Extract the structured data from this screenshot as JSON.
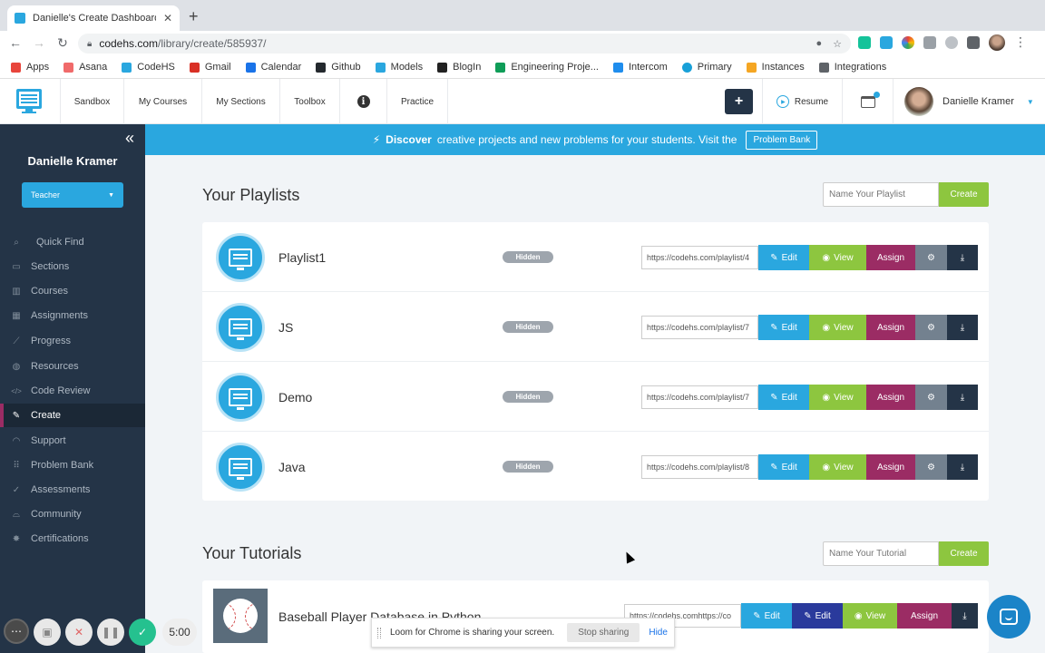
{
  "browser": {
    "tab_title": "Danielle's Create Dashboard | C",
    "tab_close": "✕",
    "new_tab": "+",
    "url_host": "codehs.com",
    "url_path": "/library/create/585937/",
    "bookmarks": [
      {
        "label": "Apps",
        "color": "#e8453c"
      },
      {
        "label": "Asana",
        "color": "#f06a6a"
      },
      {
        "label": "CodeHS",
        "color": "#2aa7df"
      },
      {
        "label": "Gmail",
        "color": "#d93025"
      },
      {
        "label": "Calendar",
        "color": "#1a73e8"
      },
      {
        "label": "Github",
        "color": "#24292e"
      },
      {
        "label": "Models",
        "color": "#2aa7df"
      },
      {
        "label": "BlogIn",
        "color": "#222222"
      },
      {
        "label": "Engineering Proje...",
        "color": "#0f9d58"
      },
      {
        "label": "Intercom",
        "color": "#1f8ded"
      },
      {
        "label": "Primary",
        "color": "#18a0d8"
      },
      {
        "label": "Instances",
        "color": "#f5a623"
      },
      {
        "label": "Integrations",
        "color": "#5f6368"
      }
    ]
  },
  "header": {
    "nav": [
      "Sandbox",
      "My Courses",
      "My Sections",
      "Toolbox",
      "Practice"
    ],
    "info": "i",
    "plus": "+",
    "resume": "Resume",
    "user_name": "Danielle Kramer"
  },
  "sidebar": {
    "user_name": "Danielle Kramer",
    "role": "Teacher",
    "items": [
      {
        "label": "Quick Find",
        "icon": "search-icon",
        "glyph": "⌕"
      },
      {
        "label": "Sections",
        "icon": "monitor-icon",
        "glyph": "▭"
      },
      {
        "label": "Courses",
        "icon": "book-icon",
        "glyph": "▥"
      },
      {
        "label": "Assignments",
        "icon": "calendar-icon",
        "glyph": "▦"
      },
      {
        "label": "Progress",
        "icon": "chart-icon",
        "glyph": "⟋"
      },
      {
        "label": "Resources",
        "icon": "bulb-icon",
        "glyph": "◍"
      },
      {
        "label": "Code Review",
        "icon": "code-icon",
        "glyph": "</>"
      },
      {
        "label": "Create",
        "icon": "pencil-icon",
        "glyph": "✎"
      },
      {
        "label": "Support",
        "icon": "headset-icon",
        "glyph": "◠"
      },
      {
        "label": "Problem Bank",
        "icon": "grid-icon",
        "glyph": "⠿"
      },
      {
        "label": "Assessments",
        "icon": "check-icon",
        "glyph": "✓"
      },
      {
        "label": "Community",
        "icon": "people-icon",
        "glyph": "⌓"
      },
      {
        "label": "Certifications",
        "icon": "badge-icon",
        "glyph": "✸"
      }
    ]
  },
  "banner": {
    "bold": "Discover",
    "text": "creative projects and new problems for your students. Visit the",
    "button": "Problem Bank"
  },
  "playlists": {
    "title": "Your Playlists",
    "input_placeholder": "Name Your Playlist",
    "create": "Create",
    "rows": [
      {
        "name": "Playlist1",
        "status": "Hidden",
        "link": "https://codehs.com/playlist/4"
      },
      {
        "name": "JS",
        "status": "Hidden",
        "link": "https://codehs.com/playlist/7"
      },
      {
        "name": "Demo",
        "status": "Hidden",
        "link": "https://codehs.com/playlist/7"
      },
      {
        "name": "Java",
        "status": "Hidden",
        "link": "https://codehs.com/playlist/8"
      }
    ],
    "actions": {
      "edit": "Edit",
      "view": "View",
      "assign": "Assign"
    }
  },
  "tutorials": {
    "title": "Your Tutorials",
    "input_placeholder": "Name Your Tutorial",
    "create": "Create",
    "row": {
      "name": "Baseball Player Database in Python",
      "link": "https://codehs.comhttps://co"
    }
  },
  "loom": {
    "message": "Loom for Chrome is sharing your screen.",
    "stop": "Stop sharing",
    "hide": "Hide"
  },
  "recorder": {
    "timer": "5:00"
  }
}
